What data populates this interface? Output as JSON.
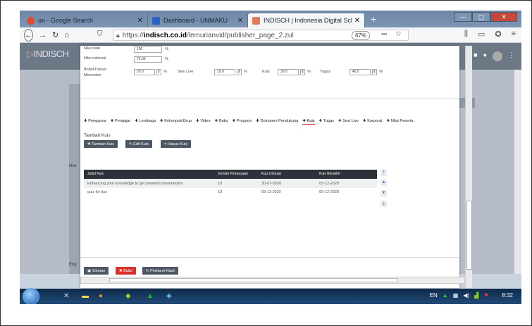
{
  "browser": {
    "tabs": [
      {
        "title": "un - Google Search",
        "close": "✕"
      },
      {
        "title": "Dashboard - UNMAKU",
        "close": "✕"
      },
      {
        "title": "INDISCH | Indonesia Digital Scl",
        "close": "✕"
      }
    ],
    "new_tab": "+",
    "window_buttons": [
      "—",
      "▢",
      "✕"
    ],
    "url_prefix": "https://",
    "url_host": "indisch.co.id",
    "url_path": "/lemurianvid/publisher_page_2.zul",
    "zoom": "67%",
    "menu_dots": "•••"
  },
  "app": {
    "logo": "INDISCH"
  },
  "background_page": {
    "snippet_1": "Hov",
    "snippet_2": "Eng"
  },
  "settings": {
    "nilai_total": {
      "label": "Nilai total",
      "value": "100",
      "unit": "%"
    },
    "nilai_minimal": {
      "label": "Nilai minimal",
      "value": "75.00",
      "unit": "%"
    },
    "bobot_durasi": {
      "label": "Bobot Durasi Menonton",
      "value": "20.0",
      "unit": "%"
    },
    "sesi_live": {
      "label": "Sesi Live",
      "value": "10.0",
      "unit": "%"
    },
    "kuis": {
      "label": "Kuis",
      "value": "30.0",
      "unit": "%"
    },
    "tugas": {
      "label": "Tugas",
      "value": "40.0",
      "unit": "%"
    }
  },
  "tabs": [
    "Pengguna",
    "Pengajar",
    "Lembaga",
    "Kelompok/Grup",
    "Video",
    "Buku",
    "Program",
    "Dokumen Pendukung",
    "Kuis",
    "Tugas",
    "Sesi Live",
    "Korporat",
    "Nilai Peserta"
  ],
  "active_tab": "Kuis",
  "section": {
    "title": "Tambah Kuis",
    "buttons": {
      "add": "Tambah Kuis",
      "edit": "Edit Kuis",
      "delete": "Hapus Kuis"
    }
  },
  "table": {
    "headers": [
      "Judul Kuis",
      "Jumlah Pertanyaan",
      "Kuis Dimulai",
      "Kuis Berakhir"
    ],
    "rows": [
      [
        "Enhancing your knowledge to get powerful presentation",
        "10",
        "30-07-2020",
        "05-12-2020"
      ],
      [
        "quiz for tips",
        "10",
        "09-11-2020",
        "05-12-2020"
      ]
    ]
  },
  "footer": {
    "simpan": "Simpan",
    "batal": "Batal",
    "perbarui": "Perbarui Hasil"
  },
  "taskbar": {
    "lang": "EN",
    "time": "8:32"
  },
  "colors": {
    "accent_red": "#d9312a",
    "dark_header": "#2d323a",
    "button_gray": "#4d5663",
    "link_blue": "#2e6ec8"
  }
}
